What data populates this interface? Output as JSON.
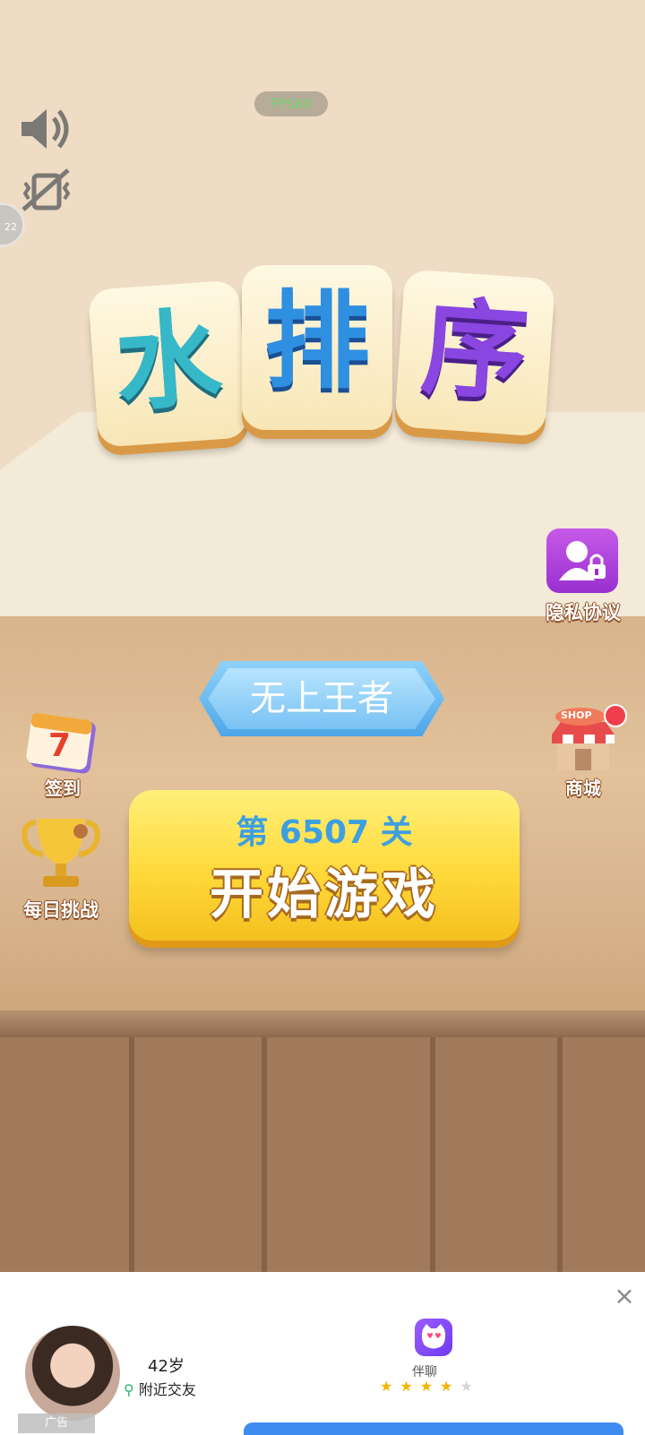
{
  "fps_label": "FPS60",
  "edge_button_label": "22",
  "title": {
    "chars": [
      "水",
      "排",
      "序"
    ],
    "colors": [
      "#37b8c8",
      "#2f8fe0",
      "#8a46e0"
    ]
  },
  "privacy": {
    "label": "隐私协议"
  },
  "rank": {
    "label": "无上王者"
  },
  "signin": {
    "label": "签到",
    "day": "7"
  },
  "shop": {
    "label": "商城",
    "badge_text": "SHOP"
  },
  "daily": {
    "label": "每日挑战"
  },
  "start": {
    "level_text": "第 6507 关",
    "label": "开始游戏"
  },
  "ad": {
    "tag": "广告",
    "age": "42岁",
    "location": "附近交友",
    "app_name": "伴聊",
    "rating": 4,
    "close_symbol": "×"
  }
}
